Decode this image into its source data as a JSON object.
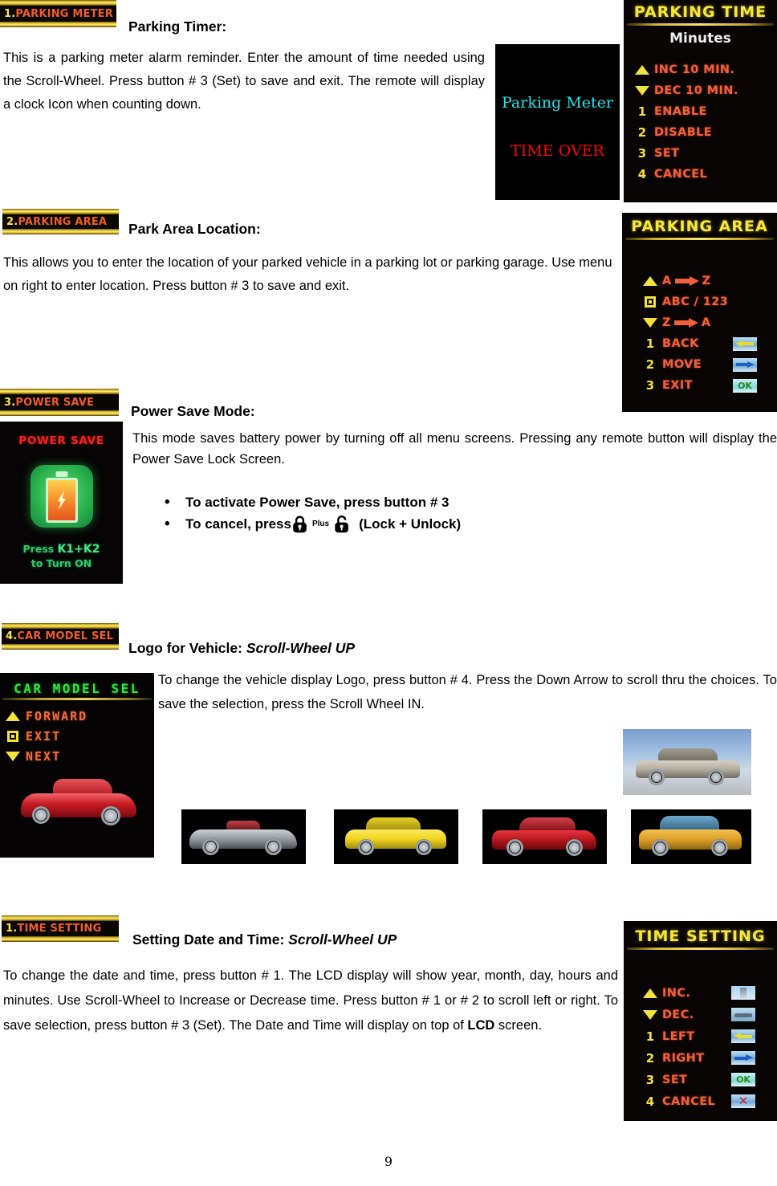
{
  "page": {
    "number": "9"
  },
  "sections": [
    {
      "banner": {
        "num": "1.",
        "name": "PARKING METER"
      },
      "heading": "Parking Timer:",
      "heading_italic": "",
      "body": "This is a parking meter alarm reminder. Enter the amount of time needed using the Scroll-Wheel. Press button # 3 (Set) to save and exit. The remote will display a clock Icon when counting down."
    },
    {
      "banner": {
        "num": "2.",
        "name": "PARKING AREA"
      },
      "heading": "Park Area Location:",
      "heading_italic": "",
      "body": "This allows you to enter the location of your parked vehicle in a parking lot or parking garage. Use menu on right to enter location. Press button # 3 to save and exit."
    },
    {
      "banner": {
        "num": "3.",
        "name": "POWER SAVE"
      },
      "heading": "Power Save Mode:",
      "heading_italic": "",
      "body": "This mode saves battery power by turning off all menu screens. Pressing any remote button will display the Power Save Lock Screen."
    },
    {
      "banner": {
        "num": "4.",
        "name": "CAR MODEL SEL"
      },
      "heading": "Logo for Vehicle:",
      "heading_italic": "Scroll-Wheel UP",
      "body": "To change the vehicle display Logo, press button # 4. Press the Down Arrow to scroll thru the choices. To save the selection, press the Scroll Wheel IN."
    },
    {
      "banner": {
        "num": "1.",
        "name": "TIME SETTING"
      },
      "heading": "Setting Date and Time:",
      "heading_italic": "Scroll-Wheel UP",
      "body_pre": "To change the date and time, press button # 1. The LCD display will show year, month, day, hours and minutes. Use Scroll-Wheel to Increase or Decrease time. Press button # 1 or # 2 to scroll left or right. To save selection, press button # 3 (Set). The Date and Time will display on top of ",
      "body_bold": "LCD",
      "body_post": " screen."
    }
  ],
  "power_save_bullets": [
    {
      "bullet": "•",
      "text": "To activate Power Save, press button # 3"
    }
  ],
  "power_save_cancel": {
    "bullet": "•",
    "lead": "To cancel, press",
    "plus": "Plus",
    "tail": "(Lock + Unlock)",
    "lock_icon": "lock-closed-icon",
    "unlock_icon": "lock-open-icon"
  },
  "parking_meter_preview": {
    "line1": "Parking Meter",
    "line2": "TIME OVER",
    "line1_color": "#19e8ef",
    "line2_color": "#f40606"
  },
  "lcd_parking_time": {
    "title": "PARKING TIME",
    "subtitle": "Minutes",
    "rows": [
      {
        "key": "▲",
        "key_type": "tri-up",
        "label": "INC 10 MIN."
      },
      {
        "key": "▼",
        "key_type": "tri-dn",
        "label": "DEC 10 MIN."
      },
      {
        "key": "1",
        "key_type": "text",
        "label": "ENABLE"
      },
      {
        "key": "2",
        "key_type": "text",
        "label": "DISABLE"
      },
      {
        "key": "3",
        "key_type": "text",
        "label": "SET"
      },
      {
        "key": "4",
        "key_type": "text",
        "label": "CANCEL"
      }
    ]
  },
  "lcd_parking_area": {
    "title": "PARKING AREA",
    "rows": [
      {
        "key": "▲",
        "key_type": "tri-up",
        "label_left": "A",
        "arrow": true,
        "label_right": "Z",
        "chip": "none"
      },
      {
        "key": "■",
        "key_type": "square",
        "label_left": "ABC / 123",
        "arrow": false,
        "label_right": "",
        "chip": "none"
      },
      {
        "key": "▼",
        "key_type": "tri-dn",
        "label_left": "Z",
        "arrow": true,
        "label_right": "A",
        "chip": "none"
      },
      {
        "key": "1",
        "key_type": "text",
        "label_left": "BACK",
        "arrow": false,
        "label_right": "",
        "chip": "left-arrow"
      },
      {
        "key": "2",
        "key_type": "text",
        "label_left": "MOVE",
        "arrow": false,
        "label_right": "",
        "chip": "right-arrow"
      },
      {
        "key": "3",
        "key_type": "text",
        "label_left": "EXIT",
        "arrow": false,
        "label_right": "",
        "chip": "ok"
      }
    ]
  },
  "lcd_time_setting": {
    "title": "TIME SETTING",
    "rows": [
      {
        "key": "▲",
        "key_type": "tri-up",
        "label": "INC.",
        "chip": "up-image"
      },
      {
        "key": "▼",
        "key_type": "tri-dn",
        "label": "DEC.",
        "chip": "down-image"
      },
      {
        "key": "1",
        "key_type": "text",
        "label": "LEFT",
        "chip": "left-arrow"
      },
      {
        "key": "2",
        "key_type": "text",
        "label": "RIGHT",
        "chip": "right-arrow"
      },
      {
        "key": "3",
        "key_type": "text",
        "label": "SET",
        "chip": "ok"
      },
      {
        "key": "4",
        "key_type": "text",
        "label": "CANCEL",
        "chip": "cancel-x"
      }
    ]
  },
  "lcd_power_save": {
    "title": "POWER SAVE",
    "foot_line1_pre": "Press ",
    "foot_line1_keys": "K1+K2",
    "foot_line2": "to Turn ON",
    "battery_icon": "battery-charging-icon"
  },
  "lcd_car_model": {
    "title": "CAR MODEL SEL",
    "rows": [
      {
        "key": "▲",
        "key_type": "tri-up",
        "label": "FORWARD"
      },
      {
        "key": "■",
        "key_type": "square",
        "label": "EXIT"
      },
      {
        "key": "▼",
        "key_type": "tri-dn",
        "label": "NEXT"
      }
    ],
    "car_photo": "red-sports-car-photo"
  },
  "car_photos": [
    {
      "name": "silver-sedan-photo",
      "color": "#b8b2a4",
      "background": "sky"
    },
    {
      "name": "grey-convertible-photo",
      "color": "#8e9396",
      "background": "black"
    },
    {
      "name": "yellow-sedan-photo",
      "color": "#f2d21a",
      "background": "black"
    },
    {
      "name": "red-coupe-photo",
      "color": "#b4161b",
      "background": "black"
    },
    {
      "name": "gold-sedan-photo",
      "color": "#e0a32b",
      "background": "black"
    }
  ],
  "chip_labels": {
    "ok": "OK",
    "cancel": "✕"
  }
}
